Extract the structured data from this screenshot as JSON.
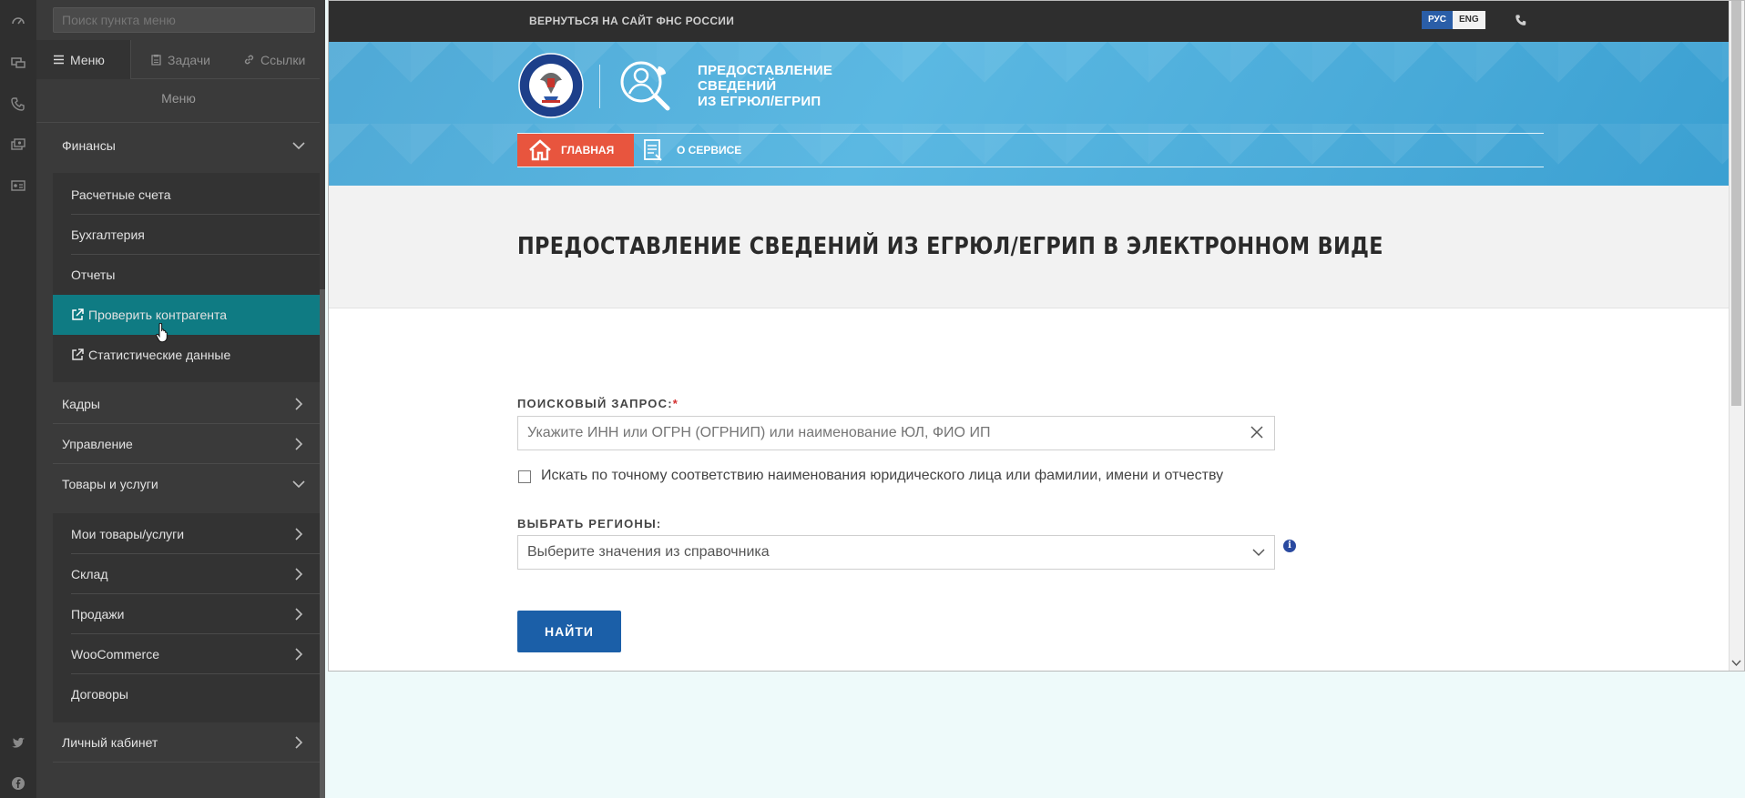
{
  "sidebar": {
    "search_placeholder": "Поиск пункта меню",
    "tabs": [
      {
        "label": "Меню",
        "icon": "menu-icon"
      },
      {
        "label": "Задачи",
        "icon": "clipboard-icon"
      },
      {
        "label": "Ссылки",
        "icon": "link-icon"
      }
    ],
    "menu_title": "Меню",
    "items": {
      "finance": "Финансы",
      "accounts": "Расчетные счета",
      "accounting": "Бухгалтерия",
      "reports": "Отчеты",
      "check_partner": "Проверить контрагента",
      "stats": "Статистические данные",
      "hr": "Кадры",
      "management": "Управление",
      "goods": "Товары и услуги",
      "my_goods": "Мои товары/услуги",
      "warehouse": "Склад",
      "sales": "Продажи",
      "woo": "WooCommerce",
      "contracts": "Договоры",
      "cabinet": "Личный кабинет"
    }
  },
  "site": {
    "back_link": "ВЕРНУТЬСЯ НА САЙТ ФНС РОССИИ",
    "lang_ru": "РУС",
    "lang_en": "ENG",
    "service_title_1": "ПРЕДОСТАВЛЕНИЕ",
    "service_title_2": "СВЕДЕНИЙ",
    "service_title_3": "ИЗ ЕГРЮЛ/ЕГРИП",
    "nav_home": "ГЛАВНАЯ",
    "nav_about": "О СЕРВИСЕ",
    "page_title": "ПРЕДОСТАВЛЕНИЕ СВЕДЕНИЙ ИЗ ЕГРЮЛ/ЕГРИП В ЭЛЕКТРОННОМ ВИДЕ",
    "query_label": "ПОИСКОВЫЙ ЗАПРОС:",
    "required_mark": "*",
    "query_placeholder": "Укажите ИНН или ОГРН (ОГРНИП) или наименование ЮЛ, ФИО ИП",
    "exact_match_label": "Искать по точному соответствию наименования юридического лица или фамилии, имени и отчеству",
    "regions_label": "ВЫБРАТЬ РЕГИОНЫ:",
    "regions_placeholder": "Выберите значения из справочника",
    "info_mark": "i",
    "find_button": "НАЙТИ"
  },
  "colors": {
    "highlight": "#0f7b83",
    "home_tab": "#e8553e",
    "find_button": "#1b5fa8",
    "hero": "#4fa9d6"
  }
}
